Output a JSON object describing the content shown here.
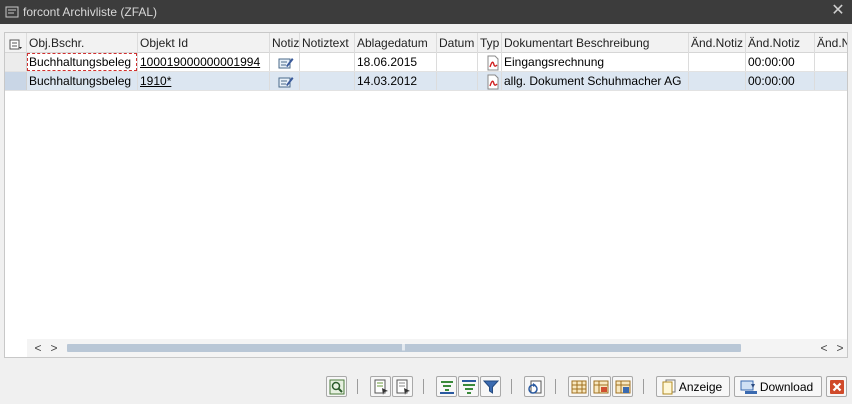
{
  "window": {
    "title": "forcont Archivliste (ZFAL)"
  },
  "columns": {
    "obj_bschr": "Obj.Bschr.",
    "objekt_id": "Objekt Id",
    "notiz": "Notiz",
    "notiztext": "Notiztext",
    "ablagedatum": "Ablagedatum",
    "datum": "Datum",
    "typ": "Typ",
    "dokumentart": "Dokumentart Beschreibung",
    "and_notiz_1": "Änd.Notiz",
    "and_notiz_2": "Änd.Notiz",
    "and_notiz_3": "Änd.N"
  },
  "rows": [
    {
      "obj_bschr": "Buchhaltungsbeleg",
      "objekt_id": "100019000000001994",
      "ablagedatum": "18.06.2015",
      "dokumentart": "Eingangsrechnung",
      "and_notiz_2": "00:00:00"
    },
    {
      "obj_bschr": "Buchhaltungsbeleg",
      "objekt_id": "1910*",
      "ablagedatum": "14.03.2012",
      "dokumentart": "allg. Dokument Schuhmacher AG",
      "and_notiz_2": "00:00:00"
    }
  ],
  "toolbar": {
    "anzeige_label": "Anzeige",
    "download_label": "Download"
  },
  "colors": {
    "titlebar": "#3c3c3c",
    "selected_row": "#dce6f1",
    "close_red": "#d04a2a"
  }
}
